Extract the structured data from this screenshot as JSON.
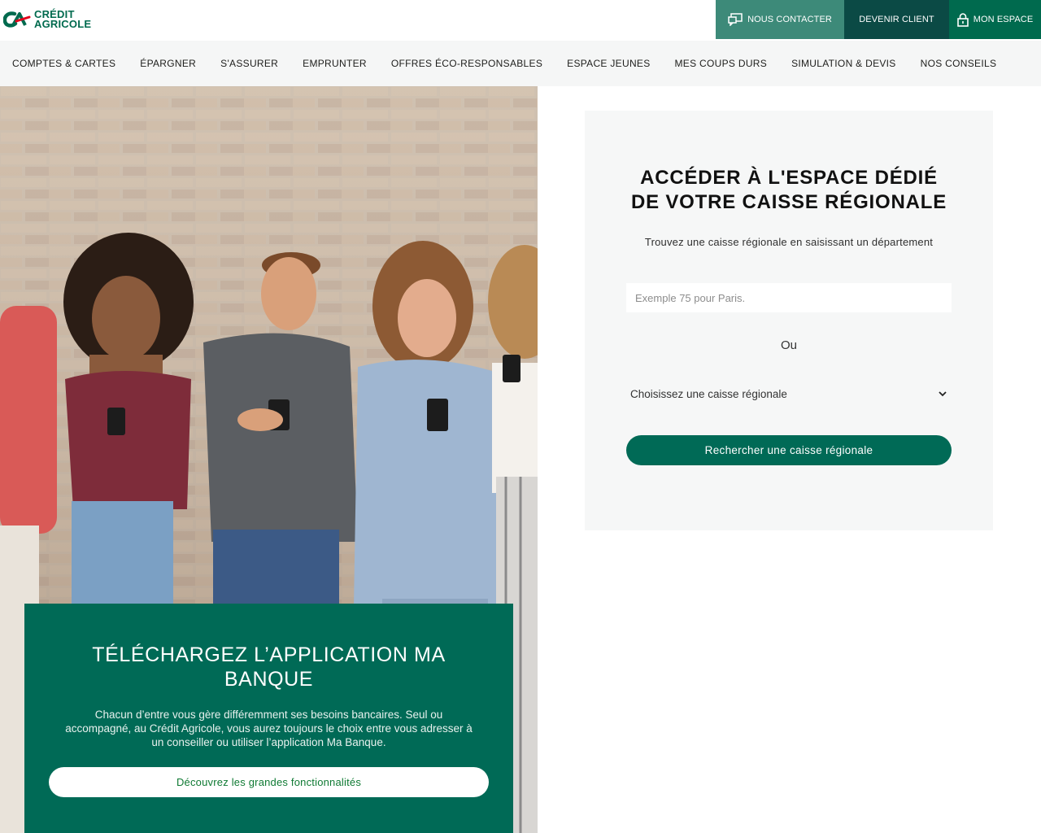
{
  "brand": {
    "name_line1": "CRÉDIT",
    "name_line2": "AGRICOLE",
    "color": "#006a4e"
  },
  "top_actions": {
    "contact": {
      "label": "NOUS CONTACTER",
      "icon": "chat-screen-icon"
    },
    "client": {
      "label": "DEVENIR CLIENT"
    },
    "espace": {
      "label": "MON ESPACE",
      "icon": "lock-icon"
    }
  },
  "nav": {
    "items": [
      "COMPTES & CARTES",
      "ÉPARGNER",
      "S'ASSURER",
      "EMPRUNTER",
      "OFFRES ÉCO-RESPONSABLES",
      "ESPACE JEUNES",
      "MES COUPS DURS",
      "SIMULATION & DEVIS",
      "NOS CONSEILS"
    ]
  },
  "promo": {
    "title": "TÉLÉCHARGEZ L’APPLICATION MA BANQUE",
    "text": "Chacun d’entre vous gère différemment ses besoins bancaires. Seul ou accompagné, au Crédit Agricole, vous aurez toujours le choix entre vous adresser à un conseiller ou utiliser l’application Ma Banque.",
    "button": "Découvrez les grandes fonctionnalités"
  },
  "regional": {
    "title": "ACCÉDER À L'ESPACE DÉDIÉ DE VOTRE CAISSE RÉGIONALE",
    "hint": "Trouvez une caisse régionale en saisissant un département",
    "input_value": "",
    "input_placeholder": "Exemple 75 pour Paris.",
    "or": "Ou",
    "select_value": "Choisissez une caisse régionale",
    "button": "Rechercher une caisse régionale"
  },
  "colors": {
    "green_dark": "#006a56",
    "teal_light": "#3d8a79",
    "teal_dark": "#0b4a45",
    "card_bg": "#f6f7f7"
  }
}
